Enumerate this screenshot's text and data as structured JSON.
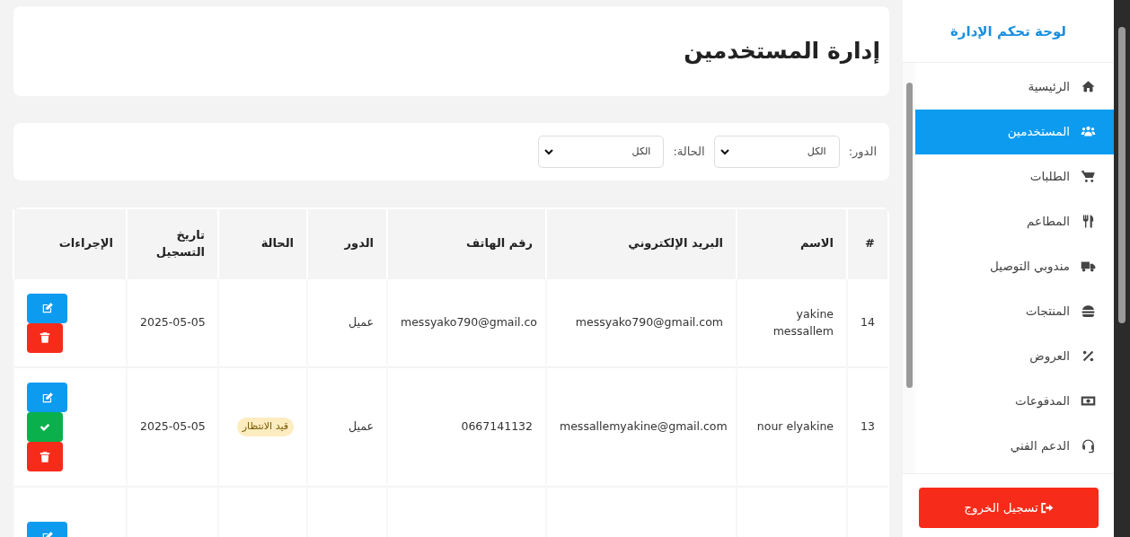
{
  "sidebar": {
    "title": "لوحة تحكم الإدارة",
    "items": [
      {
        "label": "الرئيسية",
        "selected": false
      },
      {
        "label": "المستخدمين",
        "selected": true
      },
      {
        "label": "الطلبات",
        "selected": false
      },
      {
        "label": "المطاعم",
        "selected": false
      },
      {
        "label": "مندوبي التوصيل",
        "selected": false
      },
      {
        "label": "المنتجات",
        "selected": false
      },
      {
        "label": "العروض",
        "selected": false
      },
      {
        "label": "المدفوعات",
        "selected": false
      },
      {
        "label": "الدعم الفني",
        "selected": false
      }
    ],
    "logout": "تسجيل الخروج"
  },
  "page_title": "إدارة المستخدمين",
  "filters": [
    {
      "label": "الدور:",
      "value": "الكل"
    },
    {
      "label": "الحالة:",
      "value": "الكل"
    }
  ],
  "table": {
    "columns": [
      "#",
      "الاسم",
      "البريد الإلكتروني",
      "رقم الهاتف",
      "الدور",
      "الحالة",
      "تاريخ التسجيل",
      "الإجراءات"
    ],
    "rows": [
      {
        "id": "14",
        "name": "yakine messallem",
        "email": "messyako790@gmail.com",
        "phone": "messyako790@gmail.co",
        "role": "عميل",
        "date": "2025-05-05",
        "actions": [
          {
            "kind": "edit"
          },
          {
            "kind": "delete"
          }
        ]
      },
      {
        "id": "13",
        "name": "nour elyakine",
        "email": "messallemyakine@gmail.com",
        "phone": "0667141132",
        "role": "عميل",
        "status": "قيد الانتظار",
        "date": "2025-05-05",
        "actions": [
          {
            "kind": "edit"
          },
          {
            "kind": "approve"
          },
          {
            "kind": "delete"
          }
        ]
      },
      {
        "actions": [
          {
            "kind": "edit"
          }
        ]
      }
    ]
  }
}
